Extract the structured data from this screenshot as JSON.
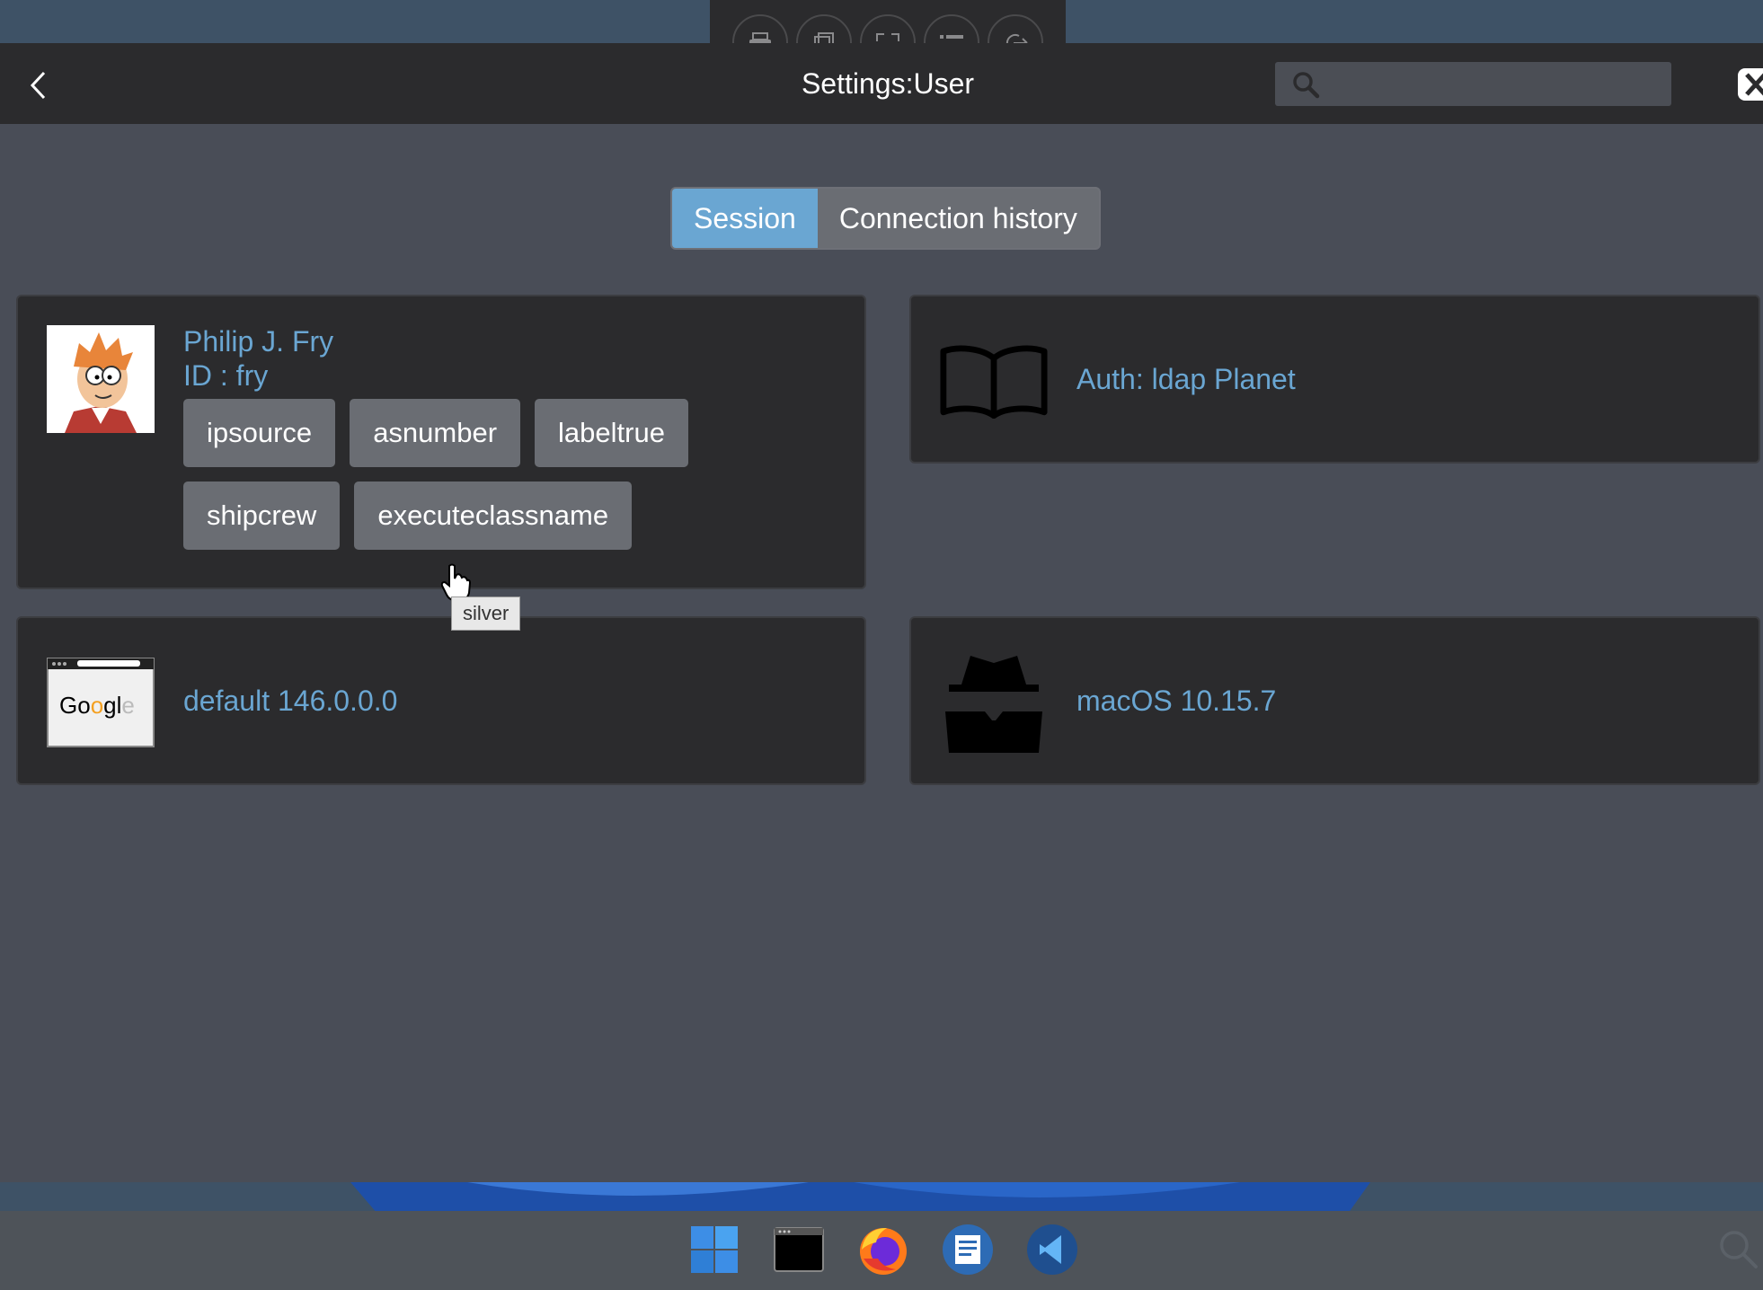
{
  "toolbar": {
    "icons": [
      "printer-icon",
      "copy-icon",
      "fullscreen-icon",
      "list-icon",
      "logout-icon"
    ]
  },
  "header": {
    "title": "Settings:User",
    "search_placeholder": "",
    "search_value": ""
  },
  "tabs": [
    {
      "label": "Session",
      "active": true
    },
    {
      "label": "Connection history",
      "active": false
    }
  ],
  "user": {
    "name": "Philip J. Fry",
    "id_text": "ID : fry",
    "groups": [
      "ipsource",
      "asnumber",
      "labeltrue",
      "shipcrew",
      "executeclassname"
    ]
  },
  "auth": {
    "label": "Auth: ldap Planet"
  },
  "browser": {
    "label": "default 146.0.0.0"
  },
  "os": {
    "label": "macOS 10.15.7"
  },
  "tooltip": {
    "text": "silver"
  },
  "colors": {
    "accent": "#6aa6d2",
    "card_bg": "#2b2b2d",
    "panel_bg": "#494d57",
    "chip_bg": "#6a6d73"
  },
  "taskbar": {
    "apps": [
      "windows-start-icon",
      "terminal-icon",
      "firefox-icon",
      "text-editor-icon",
      "vscode-icon"
    ]
  }
}
